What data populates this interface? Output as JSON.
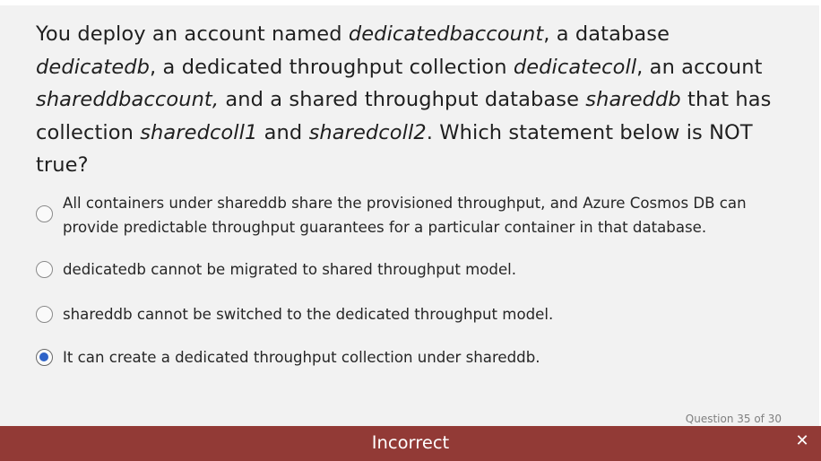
{
  "question": {
    "parts": [
      {
        "text": "You deploy an account named ",
        "italic": false
      },
      {
        "text": "dedicatedbaccount",
        "italic": true
      },
      {
        "text": ", a database ",
        "italic": false
      },
      {
        "text": "dedicatedb",
        "italic": true
      },
      {
        "text": ", a dedicated throughput collection ",
        "italic": false
      },
      {
        "text": "dedicatecoll",
        "italic": true
      },
      {
        "text": ", an account ",
        "italic": false
      },
      {
        "text": "shareddbaccount,",
        "italic": true
      },
      {
        "text": " and a shared throughput database ",
        "italic": false
      },
      {
        "text": "shareddb",
        "italic": true
      },
      {
        "text": " that has collection ",
        "italic": false
      },
      {
        "text": "sharedcoll1",
        "italic": true
      },
      {
        "text": " and ",
        "italic": false
      },
      {
        "text": "sharedcoll2",
        "italic": true
      },
      {
        "text": ". Which statement below is NOT true?",
        "italic": false
      }
    ]
  },
  "options": [
    {
      "label": "All containers under shareddb share the provisioned throughput, and Azure Cosmos DB can provide predictable throughput guarantees for a particular container in that database.",
      "selected": false
    },
    {
      "label": "dedicatedb cannot be migrated to shared throughput model.",
      "selected": false
    },
    {
      "label": "shareddb cannot be switched to the dedicated throughput model.",
      "selected": false
    },
    {
      "label": "It can create a dedicated throughput collection under shareddb.",
      "selected": true
    }
  ],
  "question_number": "Question 35 of 30",
  "result_banner": {
    "text": "Incorrect",
    "close_icon": "close-icon",
    "color": "#923a36"
  },
  "colors": {
    "panel": "#f2f2f2",
    "radio_selected": "#2e63c8"
  }
}
